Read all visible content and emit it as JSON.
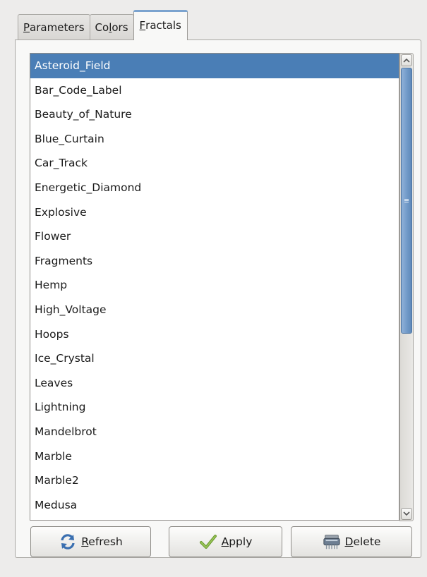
{
  "tabs": [
    {
      "mnemonic": "P",
      "rest": "arameters"
    },
    {
      "pre": "Co",
      "mnemonic": "l",
      "rest": "ors"
    },
    {
      "mnemonic": "F",
      "rest": "ractals"
    }
  ],
  "active_tab": "Fractals",
  "fractals": {
    "items": [
      "Asteroid_Field",
      "Bar_Code_Label",
      "Beauty_of_Nature",
      "Blue_Curtain",
      "Car_Track",
      "Energetic_Diamond",
      "Explosive",
      "Flower",
      "Fragments",
      "Hemp",
      "High_Voltage",
      "Hoops",
      "Ice_Crystal",
      "Leaves",
      "Lightning",
      "Mandelbrot",
      "Marble",
      "Marble2",
      "Medusa"
    ],
    "selected": "Asteroid_Field"
  },
  "scroll_fraction_visible": 0.57,
  "buttons": {
    "refresh": {
      "mnemonic": "R",
      "rest": "efresh",
      "icon": "refresh-icon"
    },
    "apply": {
      "mnemonic": "A",
      "rest": "pply",
      "icon": "checkmark-icon"
    },
    "delete": {
      "mnemonic": "D",
      "rest": "elete",
      "icon": "delete-icon"
    }
  },
  "colors": {
    "selection": "#4a7eb6",
    "tab_accent": "#7ba3cf"
  }
}
